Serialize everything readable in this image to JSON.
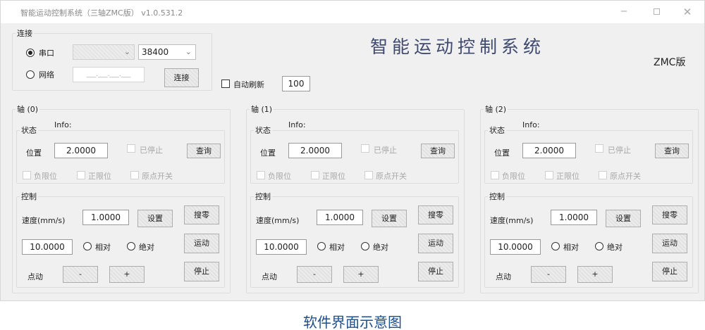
{
  "window": {
    "title": "智能运动控制系统（三轴ZMC版） v1.0.531.2",
    "min_symbol": "−",
    "close_symbol": "✕"
  },
  "connection": {
    "group_label": "连接",
    "serial_label": "串口",
    "network_label": "网络",
    "serial_selected": true,
    "port_value": "",
    "baud_value": "38400",
    "ip_value": "___.___.___.___",
    "connect_button": "连接",
    "dropdown_arrow": "⌄"
  },
  "auto_refresh": {
    "label": "自动刷新",
    "checked": false,
    "interval": "100"
  },
  "header": {
    "title": "智能运动控制系统",
    "version_label": "ZMC版"
  },
  "axes": [
    {
      "label": "轴 (0)",
      "info": "Info:",
      "status": {
        "group_label": "状态",
        "position_label": "位置",
        "position_value": "2.0000",
        "stopped_label": "已停止",
        "query_button": "查询",
        "neg_limit_label": "负限位",
        "pos_limit_label": "正限位",
        "home_switch_label": "原点开关"
      },
      "control": {
        "group_label": "控制",
        "speed_label": "速度(mm/s)",
        "speed_value": "1.0000",
        "set_button": "设置",
        "home_button": "搜零",
        "distance_value": "10.0000",
        "relative_label": "相对",
        "absolute_label": "绝对",
        "move_button": "运动",
        "jog_label": "点动",
        "jog_minus": "-",
        "jog_plus": "+",
        "stop_button": "停止"
      }
    },
    {
      "label": "轴 (1)",
      "info": "Info:",
      "status": {
        "group_label": "状态",
        "position_label": "位置",
        "position_value": "2.0000",
        "stopped_label": "已停止",
        "query_button": "查询",
        "neg_limit_label": "负限位",
        "pos_limit_label": "正限位",
        "home_switch_label": "原点开关"
      },
      "control": {
        "group_label": "控制",
        "speed_label": "速度(mm/s)",
        "speed_value": "1.0000",
        "set_button": "设置",
        "home_button": "搜零",
        "distance_value": "10.0000",
        "relative_label": "相对",
        "absolute_label": "绝对",
        "move_button": "运动",
        "jog_label": "点动",
        "jog_minus": "-",
        "jog_plus": "+",
        "stop_button": "停止"
      }
    },
    {
      "label": "轴 (2)",
      "info": "Info:",
      "status": {
        "group_label": "状态",
        "position_label": "位置",
        "position_value": "2.0000",
        "stopped_label": "已停止",
        "query_button": "查询",
        "neg_limit_label": "负限位",
        "pos_limit_label": "正限位",
        "home_switch_label": "原点开关"
      },
      "control": {
        "group_label": "控制",
        "speed_label": "速度(mm/s)",
        "speed_value": "1.0000",
        "set_button": "设置",
        "home_button": "搜零",
        "distance_value": "10.0000",
        "relative_label": "相对",
        "absolute_label": "绝对",
        "move_button": "运动",
        "jog_label": "点动",
        "jog_minus": "-",
        "jog_plus": "+",
        "stop_button": "停止"
      }
    }
  ],
  "caption": "软件界面示意图"
}
